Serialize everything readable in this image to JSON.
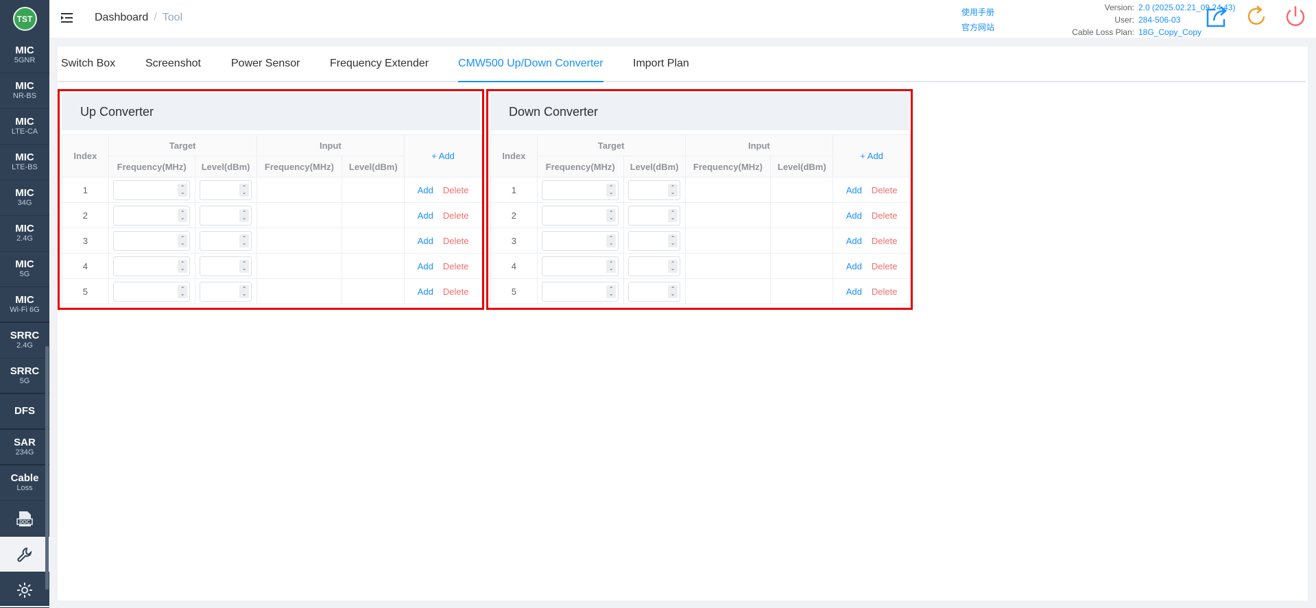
{
  "logo": {
    "text": "TST"
  },
  "sidebar": {
    "items": [
      {
        "t1": "MIC",
        "t2": "5GNR"
      },
      {
        "t1": "MIC",
        "t2": "NR-BS"
      },
      {
        "t1": "MIC",
        "t2": "LTE-CA"
      },
      {
        "t1": "MIC",
        "t2": "LTE-BS"
      },
      {
        "t1": "MIC",
        "t2": "34G"
      },
      {
        "t1": "MIC",
        "t2": "2.4G"
      },
      {
        "t1": "MIC",
        "t2": "5G"
      },
      {
        "t1": "MIC",
        "t2": "Wi-Fi 6G"
      },
      {
        "t1": "SRRC",
        "t2": "2.4G"
      },
      {
        "t1": "SRRC",
        "t2": "5G"
      },
      {
        "t1": "DFS",
        "t2": ""
      },
      {
        "t1": "SAR",
        "t2": "234G"
      },
      {
        "t1": "Cable",
        "t2": "Loss"
      }
    ],
    "doc_icon": "doc-icon",
    "tool_icon": "wrench-icon",
    "settings_icon": "gear-icon"
  },
  "header": {
    "breadcrumb": [
      "Dashboard",
      "Tool"
    ],
    "links": [
      "使用手册",
      "官方网站"
    ],
    "version_label": "Version:",
    "version_value": "2.0 (2025.02.21_09.24.43)",
    "user_label": "User:",
    "user_value": "284-506-03",
    "plan_label": "Cable Loss Plan:",
    "plan_value": "18G_Copy_Copy",
    "icons": [
      "export-icon",
      "refresh-icon",
      "power-icon"
    ]
  },
  "tabs": [
    "Switch Box",
    "Screenshot",
    "Power Sensor",
    "Frequency Extender",
    "CMW500 Up/Down Converter",
    "Import Plan"
  ],
  "active_tab": "CMW500 Up/Down Converter",
  "table_headers": {
    "index": "Index",
    "target": "Target",
    "input": "Input",
    "frequency": "Frequency(MHz)",
    "level": "Level(dBm)",
    "add": "Add"
  },
  "row_actions": {
    "add": "Add",
    "delete": "Delete"
  },
  "panels": [
    {
      "title": "Up Converter",
      "rows": [
        "1",
        "2",
        "3",
        "4",
        "5"
      ]
    },
    {
      "title": "Down Converter",
      "rows": [
        "1",
        "2",
        "3",
        "4",
        "5"
      ]
    }
  ],
  "colors": {
    "accent": "#1890ff",
    "danger": "#f56c6c",
    "highlight": "#e50000",
    "sidebar": "#304156"
  }
}
